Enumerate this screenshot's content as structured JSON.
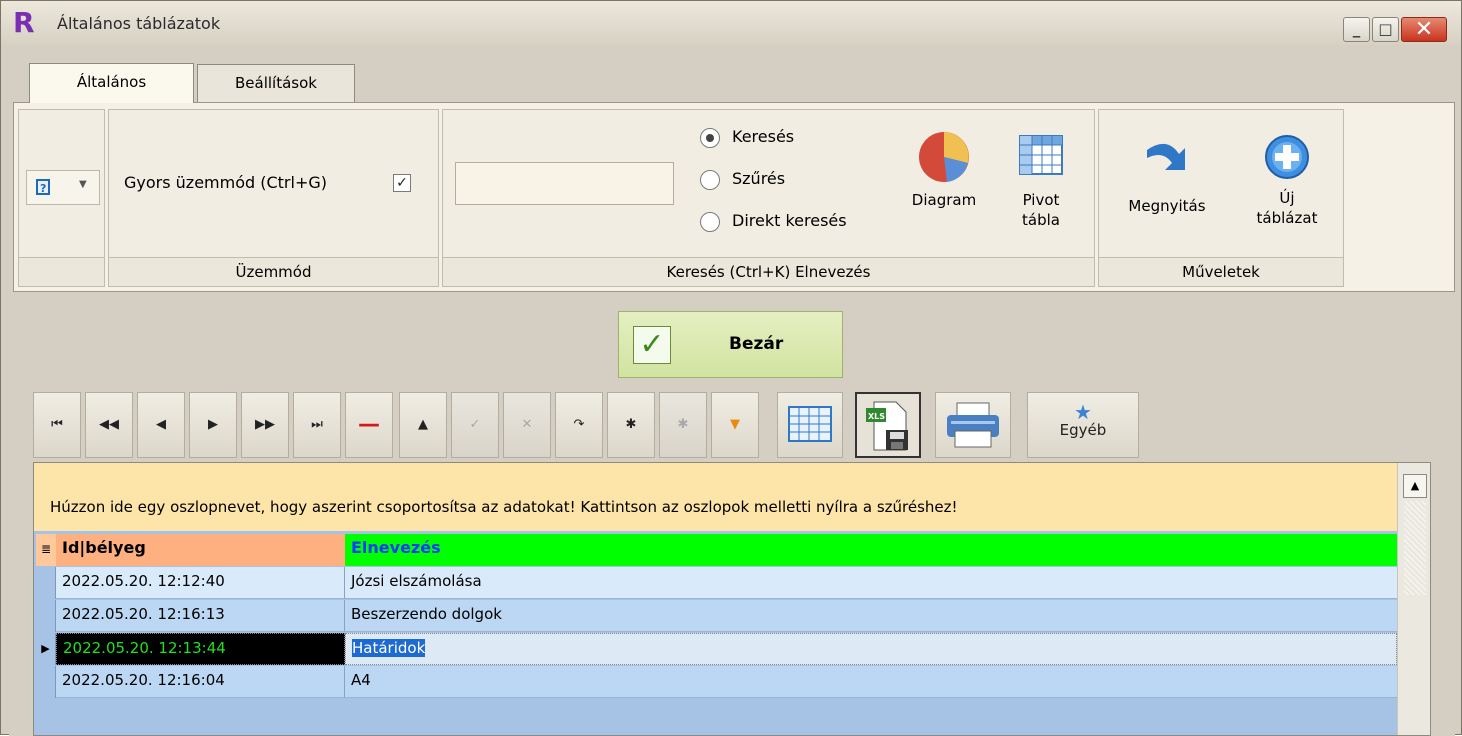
{
  "window": {
    "title": "Általános táblázatok",
    "logo_letter": "R",
    "min_glyph": "_",
    "max_glyph": "□",
    "close_glyph": "✕"
  },
  "tabs": [
    {
      "label": "Általános",
      "active": true
    },
    {
      "label": "Beállítások",
      "active": false
    }
  ],
  "ribbon": {
    "mode_group": {
      "caption": "Üzemmód",
      "quick_mode_label": "Gyors üzemmód (Ctrl+G)",
      "quick_mode_checked": true,
      "check_glyph": "✓"
    },
    "search_group": {
      "caption": "Keresés (Ctrl+K) Elnevezés",
      "search_value": "",
      "options": [
        {
          "label": "Keresés",
          "selected": true
        },
        {
          "label": "Szűrés",
          "selected": false
        },
        {
          "label": "Direkt keresés",
          "selected": false
        }
      ],
      "diagram_label": "Diagram",
      "pivot_label_1": "Pivot",
      "pivot_label_2": "tábla"
    },
    "actions_group": {
      "caption": "Műveletek",
      "open_label": "Megnyitás",
      "new_label_1": "Új",
      "new_label_2": "táblázat"
    }
  },
  "close_button": {
    "label": "Bezár",
    "icon_glyph": "✓"
  },
  "navigator": {
    "buttons": [
      {
        "name": "first-record",
        "glyph": "⏮",
        "enabled": true
      },
      {
        "name": "prev-page",
        "glyph": "◀◀",
        "enabled": true
      },
      {
        "name": "prev-record",
        "glyph": "◀",
        "enabled": true
      },
      {
        "name": "next-record",
        "glyph": "▶",
        "enabled": true
      },
      {
        "name": "next-page",
        "glyph": "▶▶",
        "enabled": true
      },
      {
        "name": "last-record",
        "glyph": "⏭",
        "enabled": true
      },
      {
        "name": "delete-record",
        "glyph": "—",
        "enabled": true
      },
      {
        "name": "edit-record",
        "glyph": "▲",
        "enabled": true
      },
      {
        "name": "post-edit",
        "glyph": "✓",
        "enabled": false
      },
      {
        "name": "cancel-edit",
        "glyph": "✕",
        "enabled": false
      },
      {
        "name": "refresh",
        "glyph": "↷",
        "enabled": true
      },
      {
        "name": "bookmark",
        "glyph": "✱",
        "enabled": true
      },
      {
        "name": "goto-bookmark",
        "glyph": "✱",
        "enabled": false
      },
      {
        "name": "filter",
        "glyph": "▼",
        "enabled": true
      }
    ],
    "other_label": "Egyéb"
  },
  "grid": {
    "group_panel_text": "Húzzon ide egy oszlopnevet, hogy aszerint csoportosítsa az adatokat! Kattintson az oszlopok melletti nyílra a szűréshez!",
    "columns": [
      "Id|bélyeg",
      "Elnevezés"
    ],
    "rows": [
      {
        "timestamp": "2022.05.20. 12:12:40",
        "name": "Józsi elszámolása"
      },
      {
        "timestamp": "2022.05.20. 12:16:13",
        "name": "Beszerzendo dolgok"
      },
      {
        "timestamp": "2022.05.20. 12:13:44",
        "name": "Határidok"
      },
      {
        "timestamp": "2022.05.20. 12:16:04",
        "name": "A4"
      }
    ],
    "selected_row_index": 2,
    "colors": {
      "timestamp_header": "#ffb081",
      "name_header": "#00ff00",
      "name_header_text": "#0a3cff",
      "group_panel": "#fde4a8",
      "selected_timestamp_bg": "#000000",
      "selected_timestamp_text": "#1fe21f"
    }
  }
}
